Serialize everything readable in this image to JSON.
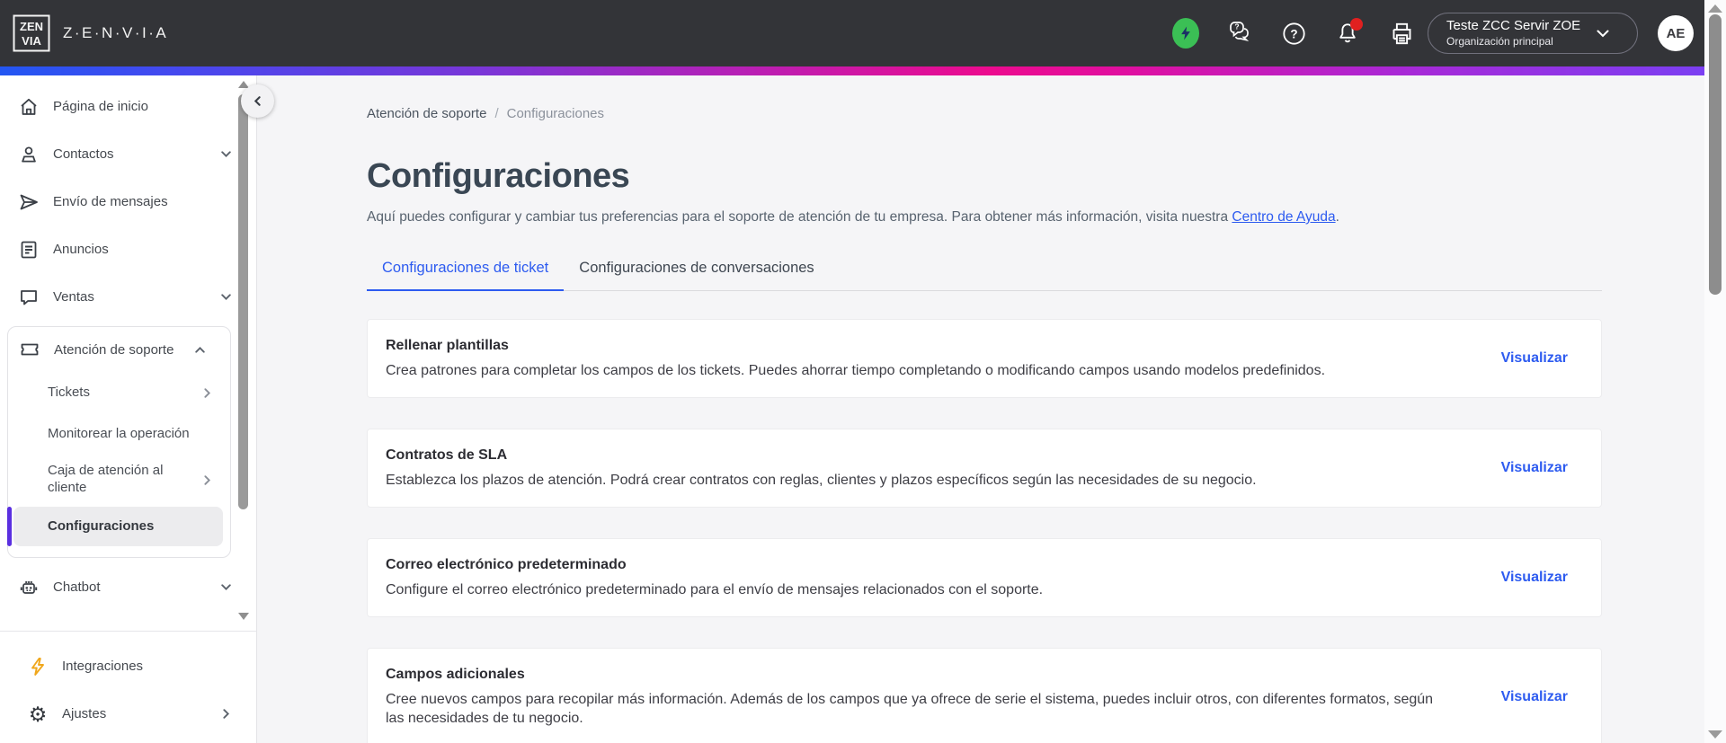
{
  "brand": {
    "wordmark": "Z·E·N·V·I·A",
    "logo_top": "ZEN",
    "logo_bottom": "VIA"
  },
  "header": {
    "org_selector": {
      "name": "Teste ZCC Servir ZOE",
      "sub": "Organización principal"
    },
    "avatar_initials": "AE"
  },
  "sidebar": {
    "items": [
      {
        "label": "Página de inicio"
      },
      {
        "label": "Contactos"
      },
      {
        "label": "Envío de mensajes"
      },
      {
        "label": "Anuncios"
      },
      {
        "label": "Ventas"
      },
      {
        "label": "Atención de soporte",
        "children": [
          {
            "label": "Tickets"
          },
          {
            "label": "Monitorear la operación"
          },
          {
            "label": "Caja de atención al cliente"
          },
          {
            "label": "Configuraciones",
            "selected": true
          }
        ]
      },
      {
        "label": "Chatbot"
      }
    ],
    "footer_items": [
      {
        "label": "Integraciones"
      },
      {
        "label": "Ajustes"
      }
    ]
  },
  "main": {
    "breadcrumb": {
      "items": [
        "Atención de soporte",
        "Configuraciones"
      ],
      "separator": "/"
    },
    "title": "Configuraciones",
    "description": "Aquí puedes configurar y cambiar tus preferencias para el soporte de atención de tu empresa. Para obtener más información, visita nuestra ",
    "description_link": "Centro de Ayuda",
    "description_suffix": ".",
    "tabs": [
      {
        "label": "Configuraciones de ticket",
        "active": true
      },
      {
        "label": "Configuraciones de conversaciones",
        "active": false
      }
    ],
    "cards": [
      {
        "title": "Rellenar plantillas",
        "description": "Crea patrones para completar los campos de los tickets. Puedes ahorrar tiempo completando o modificando campos usando modelos predefinidos.",
        "action": "Visualizar"
      },
      {
        "title": "Contratos de SLA",
        "description": "Establezca los plazos de atención. Podrá crear contratos con reglas, clientes y plazos específicos según las necesidades de su negocio.",
        "action": "Visualizar"
      },
      {
        "title": "Correo electrónico predeterminado",
        "description": "Configure el correo electrónico predeterminado para el envío de mensajes relacionados con el soporte.",
        "action": "Visualizar"
      },
      {
        "title": "Campos adicionales",
        "description": "Cree nuevos campos para recopilar más información. Además de los campos que ya ofrece de serie el sistema, puedes incluir otros, con diferentes formatos, según las necesidades de tu negocio.",
        "action": "Visualizar"
      }
    ]
  },
  "colors": {
    "header_bg": "#333438",
    "gradient": [
      "#2356f2",
      "#b91fb4",
      "#ec0b8e",
      "#7b3ff2"
    ],
    "accent_blue": "#2d5bf0",
    "selected_bar": "#5a2fe0",
    "integrations_bolt": "#f0a71c",
    "status_green": "#3bbf55",
    "notification_red": "#e02020",
    "main_bg": "#f5f5f7"
  }
}
